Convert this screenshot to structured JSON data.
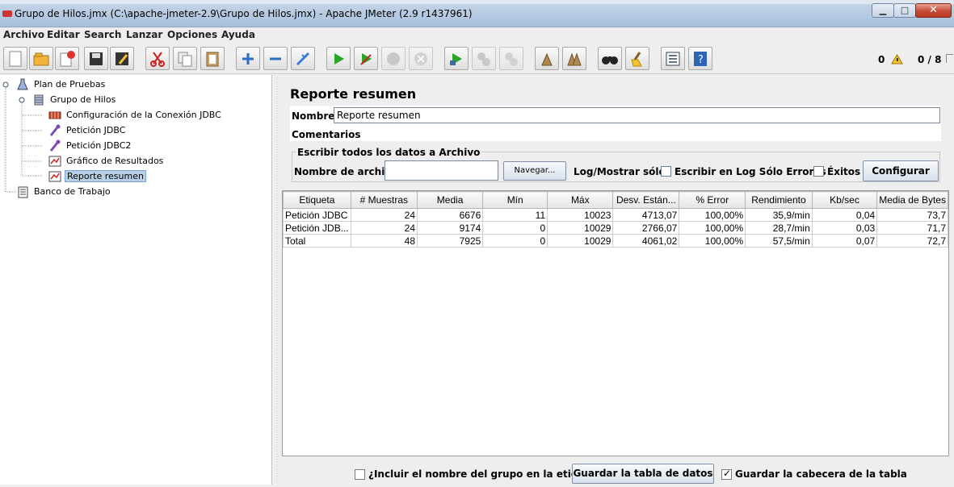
{
  "window": {
    "title": "Grupo de Hilos.jmx (C:\\apache-jmeter-2.9\\Grupo de Hilos.jmx) - Apache JMeter (2.9 r1437961)",
    "minimize_glyph": "▁",
    "maximize_glyph": "□",
    "close_glyph": "✕"
  },
  "menu": [
    "Archivo",
    "Editar",
    "Search",
    "Lanzar",
    "Opciones",
    "Ayuda"
  ],
  "status": {
    "warnings": "0",
    "threads": "0 / 8"
  },
  "tree": {
    "nodes": [
      {
        "label": "Plan de Pruebas"
      },
      {
        "label": "Grupo de Hilos"
      },
      {
        "label": "Configuración de la Conexión JDBC"
      },
      {
        "label": "Petición JDBC"
      },
      {
        "label": "Petición JDBC2"
      },
      {
        "label": "Gráfico de Resultados"
      },
      {
        "label": "Reporte resumen"
      },
      {
        "label": "Banco de Trabajo"
      }
    ]
  },
  "panel": {
    "title": "Reporte resumen",
    "name_label": "Nombre:",
    "name_value": "Reporte resumen",
    "comments_label": "Comentarios",
    "file_group_title": "Escribir todos los datos a Archivo",
    "filename_label": "Nombre de archivo",
    "filename_value": "",
    "browse_button": "Navegar...",
    "log_label": "Log/Mostrar sólo:",
    "errors_only_label": "Escribir en Log Sólo Errores",
    "success_label": "Éxitos",
    "configure_button": "Configurar"
  },
  "table": {
    "headers": [
      "Etiqueta",
      "# Muestras",
      "Media",
      "Mín",
      "Máx",
      "Desv. Están...",
      "% Error",
      "Rendimiento",
      "Kb/sec",
      "Media de Bytes"
    ],
    "rows": [
      [
        "Petición JDBC",
        "24",
        "6676",
        "11",
        "10023",
        "4713,07",
        "100,00%",
        "35,9/min",
        "0,04",
        "73,7"
      ],
      [
        "Petición JDB...",
        "24",
        "9174",
        "0",
        "10029",
        "2766,07",
        "100,00%",
        "28,7/min",
        "0,03",
        "71,7"
      ],
      [
        "Total",
        "48",
        "7925",
        "0",
        "10029",
        "4061,02",
        "100,00%",
        "57,5/min",
        "0,07",
        "72,7"
      ]
    ]
  },
  "bottom": {
    "include_group_label": "¿Incluir el nombre del grupo en la etiqueta?",
    "include_group_checked": false,
    "save_table_button": "Guardar la tabla de datos",
    "save_header_label": "Guardar la cabecera de la tabla",
    "save_header_checked": true
  },
  "colors": {
    "selection": "#b8cfe5",
    "titlebar": "#b7cbe2",
    "close_button": "#c64a33"
  }
}
